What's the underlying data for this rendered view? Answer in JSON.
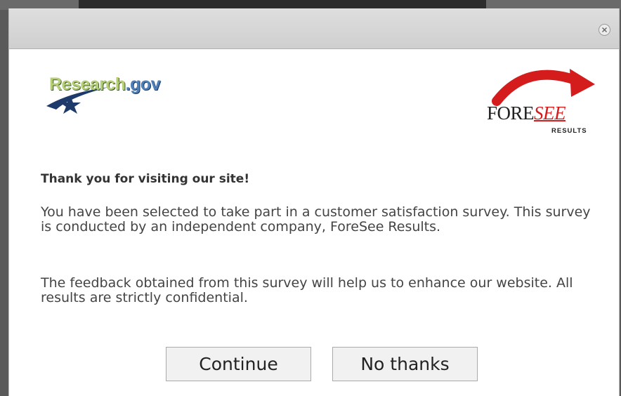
{
  "dialog": {
    "close_icon": "close-icon",
    "heading": "Thank you for visiting our site!",
    "paragraph1": "You have been selected to take part in a customer satisfaction survey. This survey is conducted by an independent company, ForeSee Results.",
    "paragraph2": "The feedback obtained from this survey will help us to enhance our website. All results are strictly confidential.",
    "continue_label": "Continue",
    "no_thanks_label": "No thanks"
  },
  "logos": {
    "research_left": "Research",
    "research_right": ".gov",
    "foresee_fore": "FORE",
    "foresee_see": "SEE",
    "foresee_results": "RESULTS"
  },
  "colors": {
    "accent_red": "#d51c1c",
    "research_green": "#b6cf74",
    "research_blue": "#4f7fb8",
    "titlebar": "#d6d6d6",
    "button_bg": "#f1f1f1"
  }
}
